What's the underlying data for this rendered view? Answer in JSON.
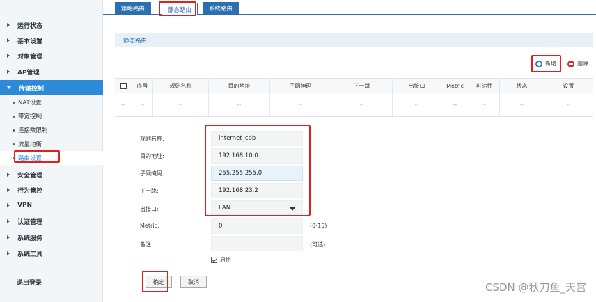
{
  "sidebar": {
    "items": [
      {
        "label": "运行状态"
      },
      {
        "label": "基本设置"
      },
      {
        "label": "对象管理"
      },
      {
        "label": "AP管理"
      },
      {
        "label": "传输控制"
      },
      {
        "label": "安全管理"
      },
      {
        "label": "行为管控"
      },
      {
        "label": "VPN"
      },
      {
        "label": "认证管理"
      },
      {
        "label": "系统服务"
      },
      {
        "label": "系统工具"
      }
    ],
    "sub_items": [
      {
        "label": "NAT设置"
      },
      {
        "label": "带宽控制"
      },
      {
        "label": "连接数限制"
      },
      {
        "label": "流量均衡"
      },
      {
        "label": "路由设置"
      }
    ],
    "logout": "退出登录"
  },
  "tabs": [
    {
      "label": "策略路由"
    },
    {
      "label": "静态路由"
    },
    {
      "label": "系统路由"
    }
  ],
  "panel": {
    "title": "静态路由",
    "add_label": "新增",
    "delete_label": "删除"
  },
  "table": {
    "columns": [
      "序号",
      "规则名称",
      "目的地址",
      "子网掩码",
      "下一跳",
      "出接口",
      "Metric",
      "可达性",
      "状态",
      "设置"
    ],
    "empty_cell": "--"
  },
  "form": {
    "rule_name": {
      "label": "规则名称:",
      "value": "internet_cpb"
    },
    "dest": {
      "label": "目的地址:",
      "value": "192.168.10.0"
    },
    "mask": {
      "label": "子网掩码:",
      "value": "255.255.255.0"
    },
    "next_hop": {
      "label": "下一跳:",
      "value": "192.168.23.2"
    },
    "out_iface": {
      "label": "出接口:",
      "value": "LAN"
    },
    "metric": {
      "label": "Metric:",
      "value": "0",
      "hint": "(0-15)"
    },
    "note": {
      "label": "备注:",
      "value": "",
      "hint": "(可选)"
    },
    "enable_label": "启用",
    "enabled": true,
    "ok_label": "确定",
    "cancel_label": "取消"
  },
  "watermark": "CSDN @秋刀鱼_天宫",
  "colors": {
    "accent": "#2c6fb0",
    "sidebar_active": "#2c8ad8",
    "highlight": "#e0201a",
    "add": "#2c7fd4",
    "delete": "#d7262c"
  }
}
